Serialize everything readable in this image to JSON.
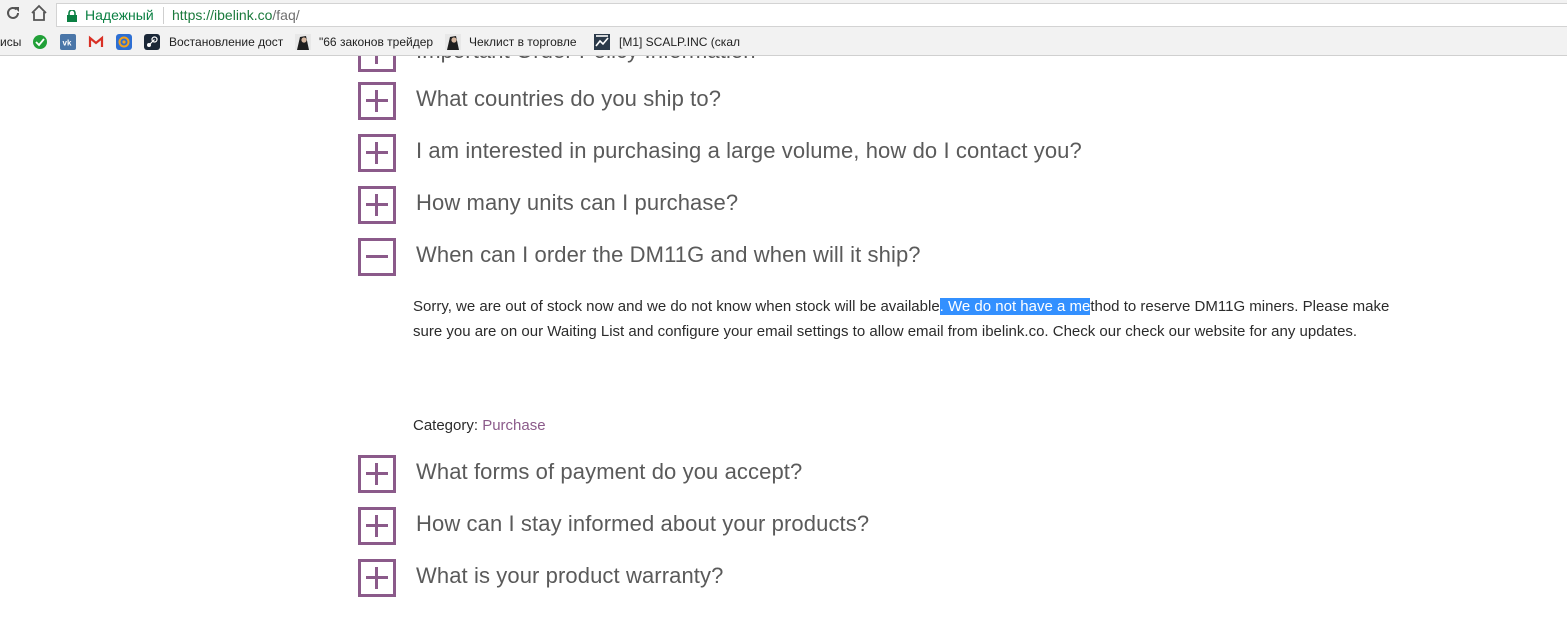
{
  "browser": {
    "secure_label": "Надежный",
    "url_host": "https://ibelink.co",
    "url_path": "/faq/"
  },
  "bookmarks": [
    {
      "label": "исы",
      "icon": "apps-icon"
    },
    {
      "label": "",
      "icon": "sberbank-icon",
      "color": "#21a038"
    },
    {
      "label": "",
      "icon": "vk-icon",
      "color": "#4a76a8"
    },
    {
      "label": "",
      "icon": "gmail-icon",
      "color": "#d93025"
    },
    {
      "label": "",
      "icon": "mail-at-icon",
      "color": "#f4a11c"
    },
    {
      "label": "Востановление дост",
      "icon": "steam-icon"
    },
    {
      "label": "\"66 законов трейдер",
      "icon": "portrait-icon"
    },
    {
      "label": "Чеклист в торговле",
      "icon": "portrait-icon"
    },
    {
      "label": "[M1] SCALP.INC (скал",
      "icon": "chart-icon"
    }
  ],
  "faq": {
    "partial_question": "Important Order Policy Information",
    "items_before": [
      "What countries do you ship to?",
      "I am interested in purchasing a large volume, how do I contact you?",
      "How many units can I purchase?"
    ],
    "open_item": {
      "question": "When can I order the DM11G and when will it ship?",
      "answer_part1": "Sorry, we are out of stock now and we do not know when stock will be available",
      "answer_selected": ". We do not have a me",
      "answer_part2": "thod to reserve DM11G miners. Please make sure you are on our Waiting List and configure your email settings to allow email from ibelink.co. Check our check our website for any updates.",
      "category_label": "Category: ",
      "category_link": "Purchase"
    },
    "items_after": [
      "What forms of payment do you accept?",
      "How can I stay informed about your products?",
      "What is your product warranty?"
    ]
  },
  "colors": {
    "accent": "#8b5a8a",
    "selection": "#3390ff",
    "secure_green": "#0b8043"
  }
}
